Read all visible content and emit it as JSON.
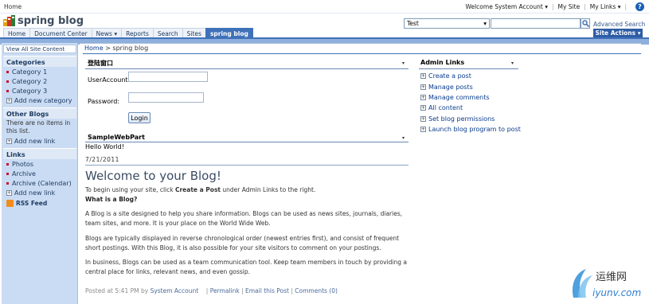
{
  "topbar": {
    "home": "Home",
    "welcome": "Welcome System Account",
    "welcome_caret": "▾",
    "my_site": "My Site",
    "my_links": "My Links",
    "my_links_caret": "▾",
    "help": "?"
  },
  "header": {
    "site_title": "spring blog",
    "search_scope": "Test",
    "search_scope_caret": "▾",
    "advanced_search": "Advanced Search"
  },
  "nav": {
    "tabs": [
      "Home",
      "Document Center",
      "News",
      "Reports",
      "Search",
      "Sites",
      "spring blog"
    ],
    "news_caret": "▾",
    "site_actions": "Site Actions",
    "site_actions_caret": "▾"
  },
  "leftnav": {
    "view_all": "View All Site Content",
    "categories_title": "Categories",
    "categories": [
      "Category 1",
      "Category 2",
      "Category 3"
    ],
    "add_category": "Add new category",
    "other_blogs_title": "Other Blogs",
    "other_blogs_note": "There are no items in this list.",
    "add_link": "Add new link",
    "links_title": "Links",
    "links": [
      "Photos",
      "Archive",
      "Archive (Calendar)"
    ],
    "add_link2": "Add new link",
    "rss": "RSS Feed"
  },
  "main": {
    "breadcrumb_home": "Home",
    "breadcrumb_sep": ">",
    "breadcrumb_current": "spring blog",
    "login_title": "登陆窗口",
    "user_label": "UserAccount:",
    "pass_label": "Password:",
    "login_button": "Login",
    "sample_title": "SampleWebPart",
    "sample_text": "Hello World!",
    "date": "7/21/2011",
    "post_title": "Welcome to your Blog!",
    "intro_pre": "To begin using your site, click ",
    "intro_bold": "Create a Post",
    "intro_post": " under Admin Links to the right.",
    "what_is": "What is a Blog?",
    "para1": "A Blog is a site designed to help you share information. Blogs can be used as news sites, journals, diaries, team sites, and more. It is your place on the World Wide Web.",
    "para2": "Blogs are typically displayed in reverse chronological order (newest entries first), and consist of frequent short postings. With this Blog, it is also possible for your site visitors to comment on your postings.",
    "para3": "In business, Blogs can be used as a team communication tool. Keep team members in touch by providing a central place for links, relevant news, and even gossip.",
    "posted_at": "Posted at 5:41 PM by",
    "posted_by": "System Account",
    "permalink": "Permalink",
    "email_post": "Email this Post",
    "comments": "Comments (0)",
    "pipe": "|",
    "menu_caret": "▾"
  },
  "admin": {
    "title": "Admin Links",
    "links": [
      "Create a post",
      "Manage posts",
      "Manage comments",
      "All content",
      "Set blog permissions",
      "Launch blog program to post"
    ]
  },
  "watermark": {
    "cn": "运维网",
    "url": "iyunv.com"
  },
  "colors": {
    "accent": "#3f71b9",
    "link": "#0a3c8c",
    "leftnav_bg": "#cadcf3"
  }
}
